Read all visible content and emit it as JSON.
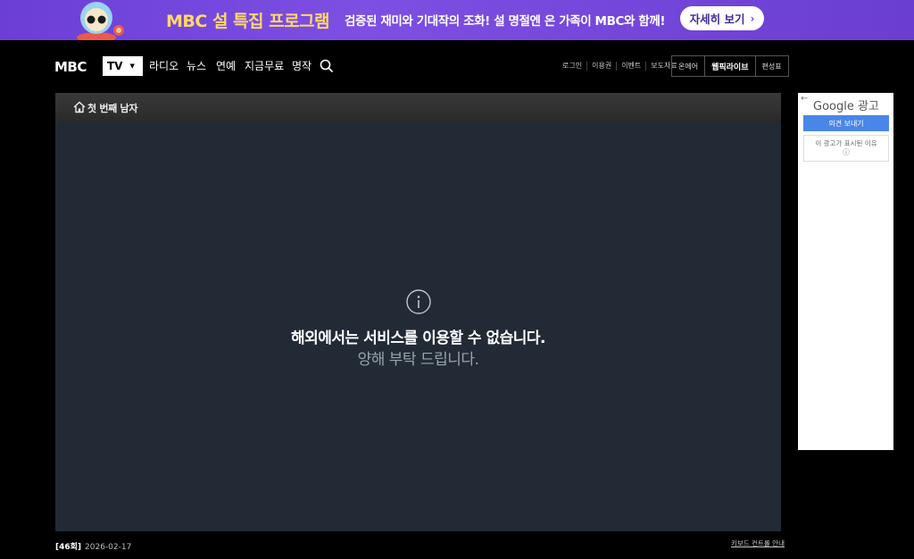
{
  "banner": {
    "title": "MBC 설 특집 프로그램",
    "text": "검증된 재미와 기대작의 조화! 설 명절엔 온 가족이 MBC와 함께!",
    "button_label": "자세히 보기",
    "title_color": "#ffd86a",
    "background": "#7d4fe3"
  },
  "gnb": {
    "logo": "MBC",
    "tv_label": "TV",
    "nav": [
      "라디오",
      "뉴스",
      "연예",
      "지금무료",
      "명작"
    ],
    "util_small": [
      "로그인",
      "이용권",
      "이벤트",
      "보도자료"
    ],
    "util_box": [
      "온에어",
      "웹픽라이브",
      "편성표"
    ]
  },
  "player": {
    "program_title": "첫 번째 남자",
    "message_main": "해외에서는 서비스를 이용할 수 없습니다.",
    "message_sub": "양해 부탁 드립니다.",
    "background": "#222b35"
  },
  "episode": {
    "number": "[46회]",
    "date": "2026-02-17"
  },
  "keyboard_guide": "키보드 컨트롤 안내",
  "ad": {
    "title": "Google 광고",
    "feedback_button": "의견 보내기",
    "why_text": "이 광고가 표시된 이유",
    "info_glyph": "ⓘ"
  }
}
